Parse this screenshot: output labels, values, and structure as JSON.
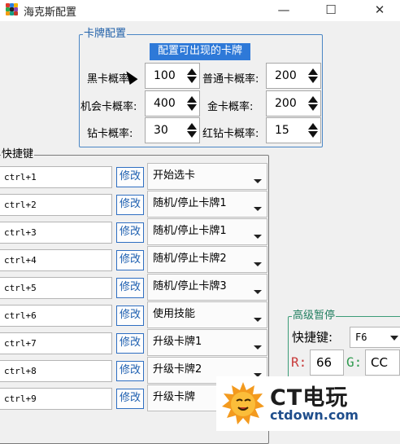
{
  "window": {
    "title": "海克斯配置",
    "minimize_glyph": "—",
    "maximize_glyph": "☐",
    "close_glyph": "✕"
  },
  "card_config": {
    "legend": "卡牌配置",
    "banner": "配置可出现的卡牌",
    "fields": [
      {
        "label": "黑卡概率:",
        "value": "100"
      },
      {
        "label": "普通卡概率:",
        "value": "200"
      },
      {
        "label": "机会卡概率:",
        "value": "400"
      },
      {
        "label": "金卡概率:",
        "value": "200"
      },
      {
        "label": "钻卡概率:",
        "value": "30"
      },
      {
        "label": "红钻卡概率:",
        "value": "15"
      }
    ]
  },
  "hotkeys": {
    "legend": "快捷键",
    "edit_label": "修改",
    "rows": [
      {
        "key": "ctrl+1",
        "action": "开始选卡"
      },
      {
        "key": "ctrl+2",
        "action": "随机/停止卡牌1"
      },
      {
        "key": "ctrl+3",
        "action": "随机/停止卡牌1"
      },
      {
        "key": "ctrl+4",
        "action": "随机/停止卡牌2"
      },
      {
        "key": "ctrl+5",
        "action": "随机/停止卡牌3"
      },
      {
        "key": "ctrl+6",
        "action": "使用技能"
      },
      {
        "key": "ctrl+7",
        "action": "升级卡牌1"
      },
      {
        "key": "ctrl+8",
        "action": "升级卡牌2"
      },
      {
        "key": "ctrl+9",
        "action": "升级卡牌"
      }
    ]
  },
  "advanced_pause": {
    "legend": "高级暂停",
    "hotkey_label": "快捷键:",
    "hotkey_value": "F6",
    "r_label": "R:",
    "r_value": "66",
    "g_label": "G:",
    "g_value": "CC"
  },
  "watermark": {
    "title": "CT电玩",
    "subtitle": "ctdown.com"
  },
  "colors": {
    "banner_bg": "#2e79d8",
    "group_border": "#4a86c5",
    "edit_button_text": "#1d5fb0",
    "advanced_legend": "#1f7d5e",
    "watermark_logo": "#f39a1e"
  }
}
